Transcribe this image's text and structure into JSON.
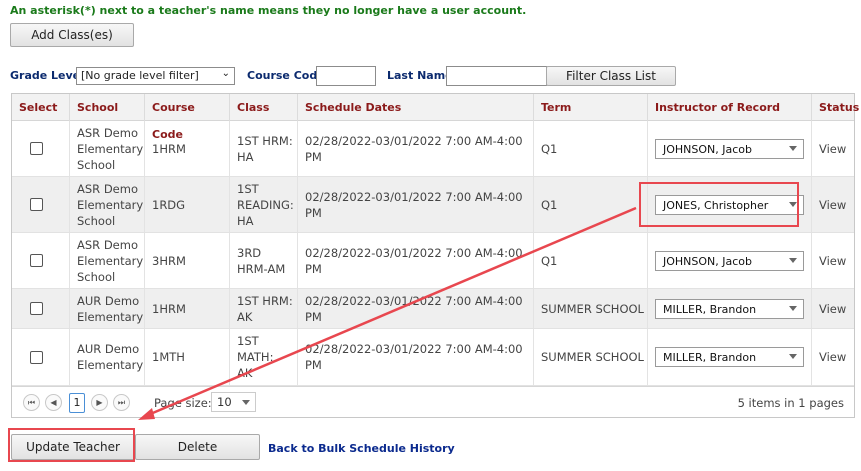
{
  "note": "An asterisk(*) next to a teacher's name means they no longer have a user account.",
  "add_class_button": "Add Class(es)",
  "filters": {
    "grade_level_label": "Grade Level",
    "grade_level_value": "[No grade level filter]",
    "course_code_label": "Course Code",
    "course_code_value": "",
    "last_name_label": "Last Name",
    "last_name_value": "",
    "filter_button": "Filter Class List"
  },
  "columns": [
    "Select",
    "School",
    "Course Code",
    "Class",
    "Schedule Dates",
    "Term",
    "Instructor of Record",
    "Status"
  ],
  "rows": [
    {
      "school": [
        "ASR Demo",
        "Elementary",
        "School"
      ],
      "course_code": "1HRM",
      "class": [
        "1ST HRM:",
        "HA"
      ],
      "dates": "02/28/2022-03/01/2022 7:00 AM-4:00 PM",
      "term": "Q1",
      "instructor": "JOHNSON, Jacob",
      "status": "View"
    },
    {
      "school": [
        "ASR Demo",
        "Elementary",
        "School"
      ],
      "course_code": "1RDG",
      "class": [
        "1ST",
        "READING:",
        "HA"
      ],
      "dates": "02/28/2022-03/01/2022 7:00 AM-4:00 PM",
      "term": "Q1",
      "instructor": "JONES, Christopher",
      "status": "View"
    },
    {
      "school": [
        "ASR Demo",
        "Elementary",
        "School"
      ],
      "course_code": "3HRM",
      "class": [
        "3RD",
        "HRM-AM"
      ],
      "dates": "02/28/2022-03/01/2022 7:00 AM-4:00 PM",
      "term": "Q1",
      "instructor": "JOHNSON, Jacob",
      "status": "View"
    },
    {
      "school": [
        "AUR Demo",
        "Elementary"
      ],
      "course_code": "1HRM",
      "class": [
        "1ST HRM:",
        "AK"
      ],
      "dates": "02/28/2022-03/01/2022 7:00 AM-4:00 PM",
      "term": "SUMMER SCHOOL",
      "instructor": "MILLER, Brandon",
      "status": "View"
    },
    {
      "school": [
        "AUR Demo",
        "Elementary"
      ],
      "course_code": "1MTH",
      "class": [
        "1ST",
        "MATH:",
        "AK"
      ],
      "dates": "02/28/2022-03/01/2022 7:00 AM-4:00 PM",
      "term": "SUMMER SCHOOL",
      "instructor": "MILLER, Brandon",
      "status": "View"
    }
  ],
  "pager": {
    "first": "⏮",
    "prev": "◀",
    "current_page": "1",
    "next": "▶",
    "last": "⏭",
    "page_size_label": "Page size:",
    "page_size_value": "10",
    "summary": "5 items in 1 pages"
  },
  "update_teacher_button": "Update Teacher",
  "delete_button": "Delete",
  "back_link": "Back to Bulk Schedule History",
  "colors": {
    "header_text": "#8b1a1a",
    "label_text": "#0b2a6e",
    "note_text": "#1a7a1a",
    "highlight": "#e8474f"
  }
}
